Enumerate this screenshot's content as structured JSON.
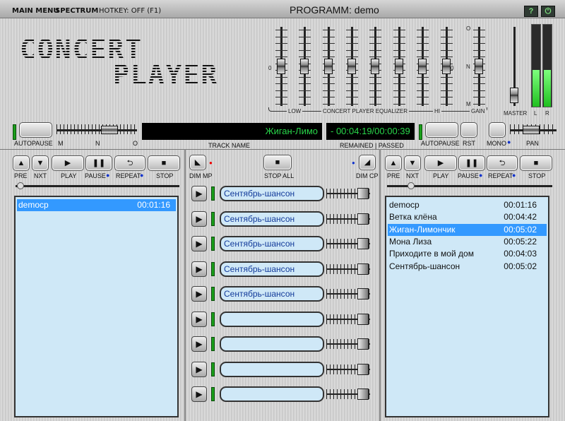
{
  "menu": {
    "main": "MAIN MENU",
    "spectrum": "SPECTRUM",
    "hotkey": "HOTKEY: OFF (F1)"
  },
  "window": {
    "title": "PROGRAMM: demo",
    "help": "?",
    "power": "⏻"
  },
  "logo": {
    "line1": "CONCERT",
    "line2": "PLAYER"
  },
  "equalizer": {
    "label_low": "LOW",
    "label_center": "CONCERT PLAYER EQUALIZER",
    "label_hi": "HI",
    "label_gain": "GAIN",
    "label_zero": "0",
    "gain_o": "O",
    "gain_n": "N",
    "gain_m": "M",
    "band_levels": [
      0.5,
      0.5,
      0.5,
      0.5,
      0.5,
      0.5,
      0.5,
      0.5
    ],
    "gain_level": 0.5
  },
  "master": {
    "label": "MASTER",
    "l": "L",
    "r": "R",
    "level": 0.05,
    "vu_l": 0.45,
    "vu_r": 0.45
  },
  "left_deck": {
    "autopause": "AUTOPAUSE",
    "scale_m": "M",
    "scale_n": "N",
    "scale_o": "O",
    "pre": "PRE",
    "nxt": "NXT",
    "play": "PLAY",
    "pause": "PAUSE",
    "repeat": "REPEAT",
    "stop": "STOP",
    "playlist": [
      {
        "name": "demoср",
        "time": "00:01:16"
      }
    ]
  },
  "center": {
    "track_display": "Жиган-Лимо",
    "time_display": "- 00:04:19/00:00:39",
    "track_name_label": "TRACK NAME",
    "remained_label": "REMAINED | PASSED",
    "dim_mp": "DIM MP",
    "stop_all": "STOP ALL",
    "dim_cp": "DIM CP",
    "slots": [
      "Сентябрь-шансон",
      "Сентябрь-шансон",
      "Сентябрь-шансон",
      "Сентябрь-шансон",
      "Сентябрь-шансон",
      "",
      "",
      "",
      ""
    ]
  },
  "right_deck": {
    "autopause": "AUTOPAUSE",
    "rst": "RST",
    "mono": "MONO",
    "pan": "PAN",
    "pre": "PRE",
    "nxt": "NXT",
    "play": "PLAY",
    "pause": "PAUSE",
    "repeat": "REPEAT",
    "stop": "STOP",
    "playlist": [
      {
        "name": "demoср",
        "time": "00:01:16"
      },
      {
        "name": "Ветка клёна",
        "time": "00:04:42"
      },
      {
        "name": "Жиган-Лимончик",
        "time": "00:05:02",
        "selected": true
      },
      {
        "name": "Мона Лиза",
        "time": "00:05:22"
      },
      {
        "name": "Приходите в мой дом",
        "time": "00:04:03"
      },
      {
        "name": "Сентябрь-шансон",
        "time": "00:05:02"
      }
    ]
  }
}
